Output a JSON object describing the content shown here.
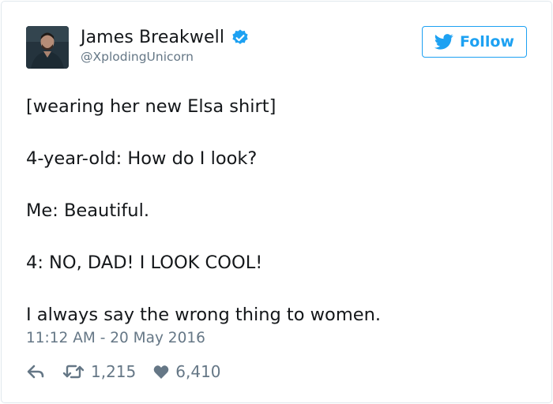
{
  "tweet": {
    "author": {
      "name": "James Breakwell",
      "handle": "@XplodingUnicorn",
      "verified": true,
      "avatar_icon": "avatar-photo"
    },
    "follow_button": {
      "label": "Follow",
      "icon": "twitter-bird-icon"
    },
    "lines": [
      "[wearing her new Elsa shirt]",
      "4-year-old: How do I look?",
      "Me: Beautiful.",
      "4: NO, DAD! I LOOK COOL!",
      "I always say the wrong thing to women."
    ],
    "timestamp": "11:12 AM - 20 May 2016",
    "actions": {
      "reply_icon": "reply-icon",
      "retweet_icon": "retweet-icon",
      "retweet_count": "1,215",
      "like_icon": "heart-icon",
      "like_count": "6,410"
    }
  },
  "colors": {
    "accent": "#1da1f2",
    "text": "#14171a",
    "muted": "#657786",
    "border": "#e1e8ed"
  }
}
